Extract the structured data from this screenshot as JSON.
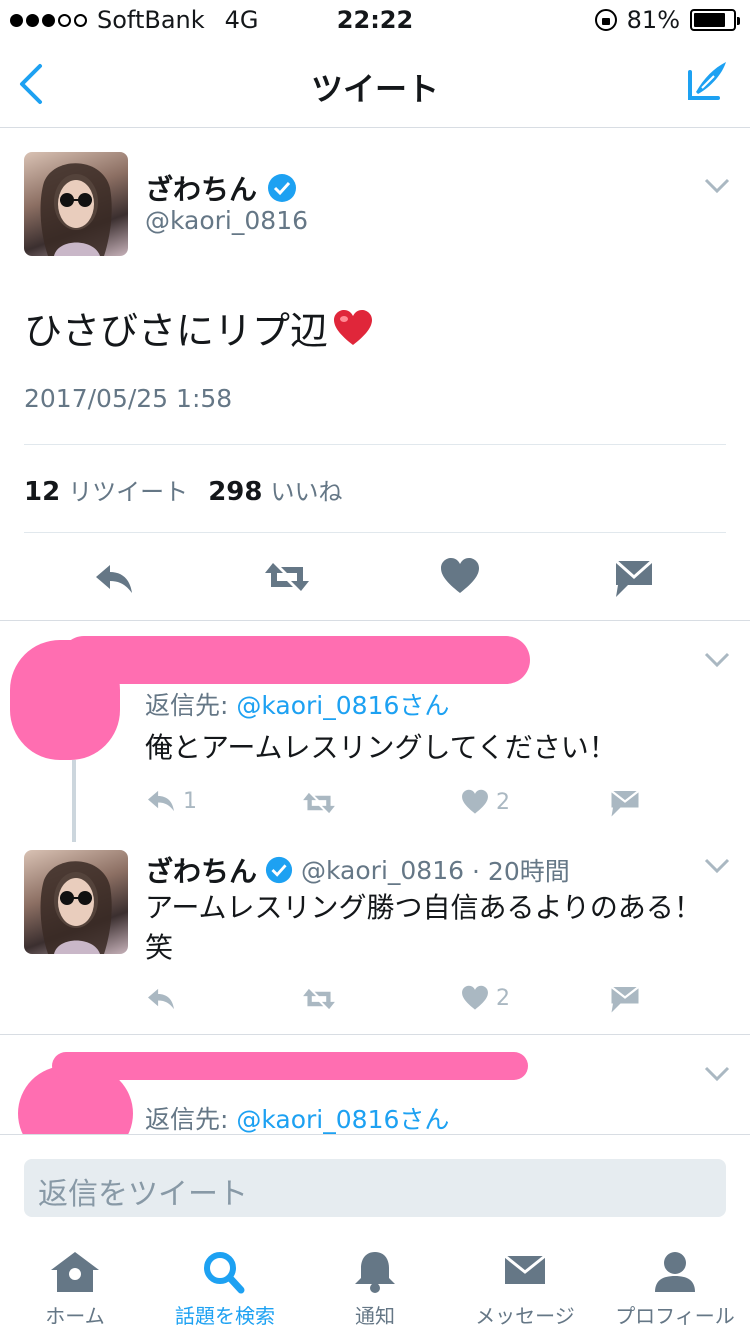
{
  "status_bar": {
    "carrier": "SoftBank",
    "network": "4G",
    "time": "22:22",
    "battery": "81%",
    "battery_level": 0.81
  },
  "nav": {
    "title": "ツイート",
    "back_icon": "chevron-left-icon",
    "compose_icon": "compose-tweet-icon"
  },
  "tweet": {
    "name": "ざわちん",
    "handle": "@kaori_0816",
    "text": "ひさびさにリプ辺",
    "emoji": "❤️",
    "date": "2017/05/25 1:58",
    "retweets": "12",
    "retweets_label": "リツイート",
    "likes": "298",
    "likes_label": "いいね"
  },
  "replies": [
    {
      "reply_to_prefix": "返信先: ",
      "reply_to_handle": "@kaori_0816さん",
      "text": "俺とアームレスリングしてください！",
      "reply_count": "1",
      "like_count": "2"
    },
    {
      "name": "ざわちん",
      "handle": "@kaori_0816",
      "time": "· 20時間",
      "text": "アームレスリング勝つ自信あるよりのある！笑",
      "like_count": "2"
    },
    {
      "reply_to_prefix": "返信先: ",
      "reply_to_handle": "@kaori_0816さん"
    }
  ],
  "composer": {
    "placeholder": "返信をツイート"
  },
  "tabs": [
    {
      "label": "ホーム",
      "icon": "home-icon"
    },
    {
      "label": "話題を検索",
      "icon": "search-icon",
      "active": true
    },
    {
      "label": "通知",
      "icon": "bell-icon"
    },
    {
      "label": "メッセージ",
      "icon": "mail-icon"
    },
    {
      "label": "プロフィール",
      "icon": "profile-icon"
    }
  ],
  "colors": {
    "accent": "#1da1f2",
    "muted": "#657786",
    "redaction": "#ff6eb1",
    "action_icon": "#657786"
  }
}
